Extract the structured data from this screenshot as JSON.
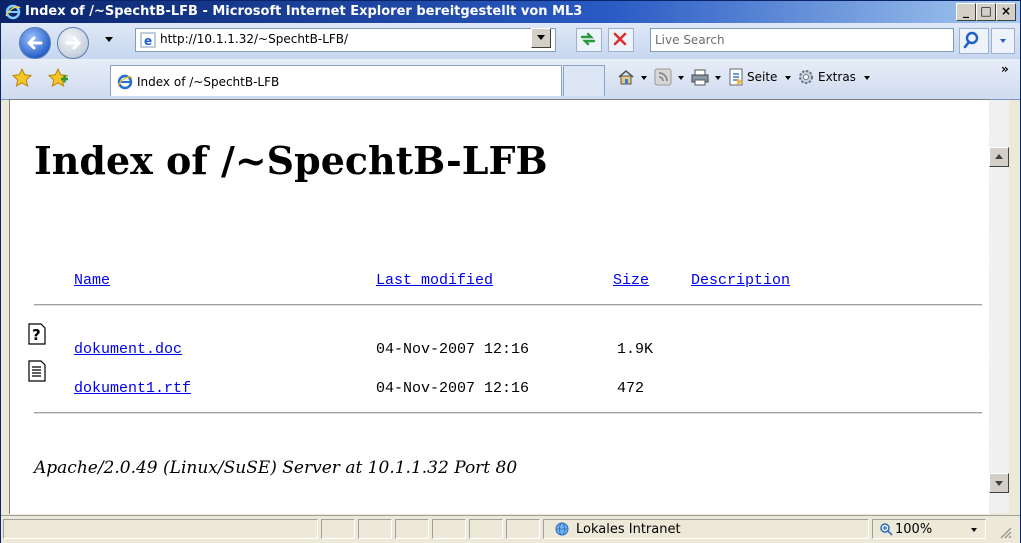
{
  "window": {
    "title": "Index of /~SpechtB-LFB - Microsoft Internet Explorer bereitgestellt von ML3",
    "minimize": "_",
    "maximize": "□",
    "close": "×"
  },
  "navbar": {
    "address": "http://10.1.1.32/~SpechtB-LFB/",
    "search_placeholder": "Live Search"
  },
  "cmdbar": {
    "tab_label": "Index of /~SpechtB-LFB",
    "page_label": "Seite",
    "tools_label": "Extras",
    "overflow": "»"
  },
  "page": {
    "heading": "Index of /~SpechtB-LFB",
    "columns": {
      "name": "Name",
      "last_modified": "Last modified",
      "size": "Size",
      "description": "Description"
    },
    "files": [
      {
        "name": "dokument.doc",
        "modified": "04-Nov-2007 12:16",
        "size": "1.9K",
        "icon": "unknown-file-icon"
      },
      {
        "name": "dokument1.rtf",
        "modified": "04-Nov-2007 12:16",
        "size": "472",
        "icon": "text-file-icon"
      }
    ],
    "server_line": "Apache/2.0.49 (Linux/SuSE) Server at 10.1.1.32 Port 80"
  },
  "status": {
    "zone": "Lokales Intranet",
    "zoom": "100%"
  }
}
